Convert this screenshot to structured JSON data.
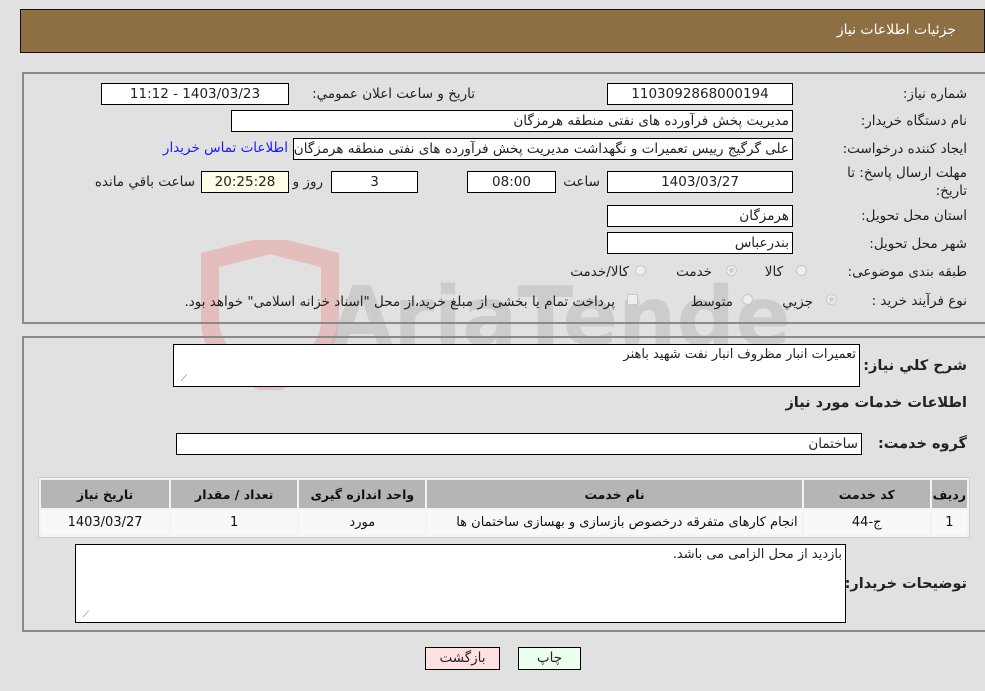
{
  "header": {
    "title": "جزئیات اطلاعات نیاز"
  },
  "form": {
    "need_number": {
      "label": "شماره نیاز:",
      "value": "1103092868000194"
    },
    "announce_datetime": {
      "label": "تاریخ و ساعت اعلان عمومي:",
      "value": "1403/03/23 - 11:12"
    },
    "buyer_org": {
      "label": "نام دستگاه خريدار:",
      "value": "مديريت پخش فرآورده هاى نفتى منطقه هرمزگان"
    },
    "requester": {
      "label": "ايجاد کننده درخواست:",
      "value": "على گرگيج رييس تعميرات و نگهداشت مديريت پخش فرآورده هاى نفتى منطقه هرمزگان"
    },
    "buyer_contact_link": "اطلاعات تماس خريدار",
    "deadline": {
      "label_line1": "مهلت ارسال پاسخ: تا",
      "label_line2": "تاريخ:",
      "date": "1403/03/27",
      "time_label": "ساعت",
      "time": "08:00",
      "days": "3",
      "days_label": "روز و",
      "remaining": "20:25:28",
      "remaining_label": "ساعت باقي مانده"
    },
    "province": {
      "label": "استان محل تحويل:",
      "value": "هرمزگان"
    },
    "city": {
      "label": "شهر محل تحويل:",
      "value": "بندرعباس"
    },
    "category": {
      "label": "طبقه بندی موضوعی:",
      "options": [
        "کالا",
        "خدمت",
        "کالا/خدمت"
      ],
      "selected": "خدمت"
    },
    "purchase_type": {
      "label": "نوع فرآيند خريد :",
      "options": [
        "جزيي",
        "متوسط"
      ],
      "selected": "جزيي",
      "treasury_note": "پرداخت تمام يا بخشى از مبلغ خريد،از محل \"اسناد خزانه اسلامى\" خواهد بود."
    }
  },
  "details": {
    "description_label": "شرح کلي نياز:",
    "description": "تعميرات انبار مظروف انبار نفت شهيد باهنر",
    "services_heading": "اطلاعات خدمات مورد نياز",
    "service_group_label": "گروه خدمت:",
    "service_group": "ساختمان",
    "table": {
      "columns": [
        "رديف",
        "کد خدمت",
        "نام خدمت",
        "واحد اندازه گيری",
        "تعداد / مقدار",
        "تاريخ نياز"
      ],
      "rows": [
        [
          "1",
          "ج-44",
          "انجام کارهای متفرقه درخصوص بازسازی و بهسازی ساختمان ها",
          "مورد",
          "1",
          "1403/03/27"
        ]
      ]
    },
    "buyer_notes_label": "توضيحات خريدار:",
    "buyer_notes": "بازديد از محل الزامى مى باشد."
  },
  "buttons": {
    "print": "چاپ",
    "back": "بازگشت"
  },
  "watermark": "AriaTender.neT",
  "colors": {
    "header": "#8e6e43",
    "print_bg": "#ecffec",
    "back_bg": "#ffe1e1",
    "link": "#1a1aff"
  }
}
